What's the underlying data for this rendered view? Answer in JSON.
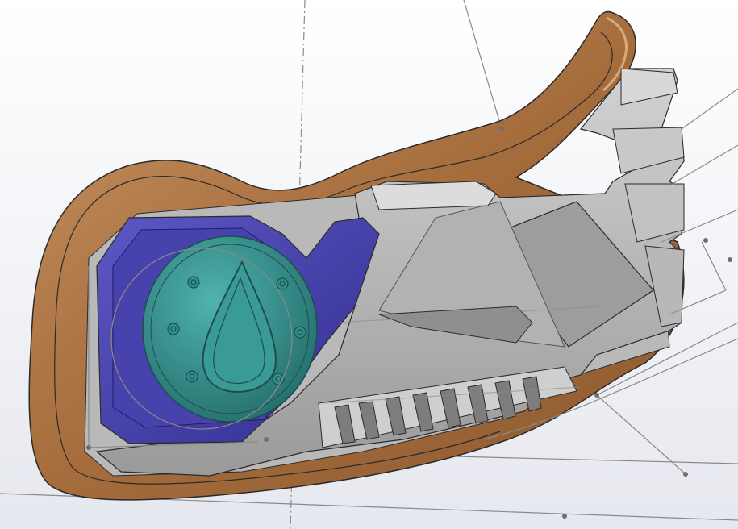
{
  "viewport": {
    "background_top": "#ffffff",
    "background_bottom": "#e6e8ef"
  },
  "model": {
    "shell_color": "#a56c3c",
    "shell_highlight": "#c99463",
    "shell_inner": "#8c5a30",
    "body_color": "#a9a9a9",
    "body_light": "#c9c9c9",
    "body_dark": "#7d7d7d",
    "cavity_color": "#3f3aa3",
    "cavity_light": "#5d58c4",
    "disc_color": "#2e8f8d",
    "disc_light": "#4fb3ae",
    "sketch_color": "#7a7a7a",
    "edge_color": "#2b2b2b"
  },
  "icons": {
    "disc_emblem": "teardrop-icon",
    "screw": "screw-hole-icon"
  }
}
